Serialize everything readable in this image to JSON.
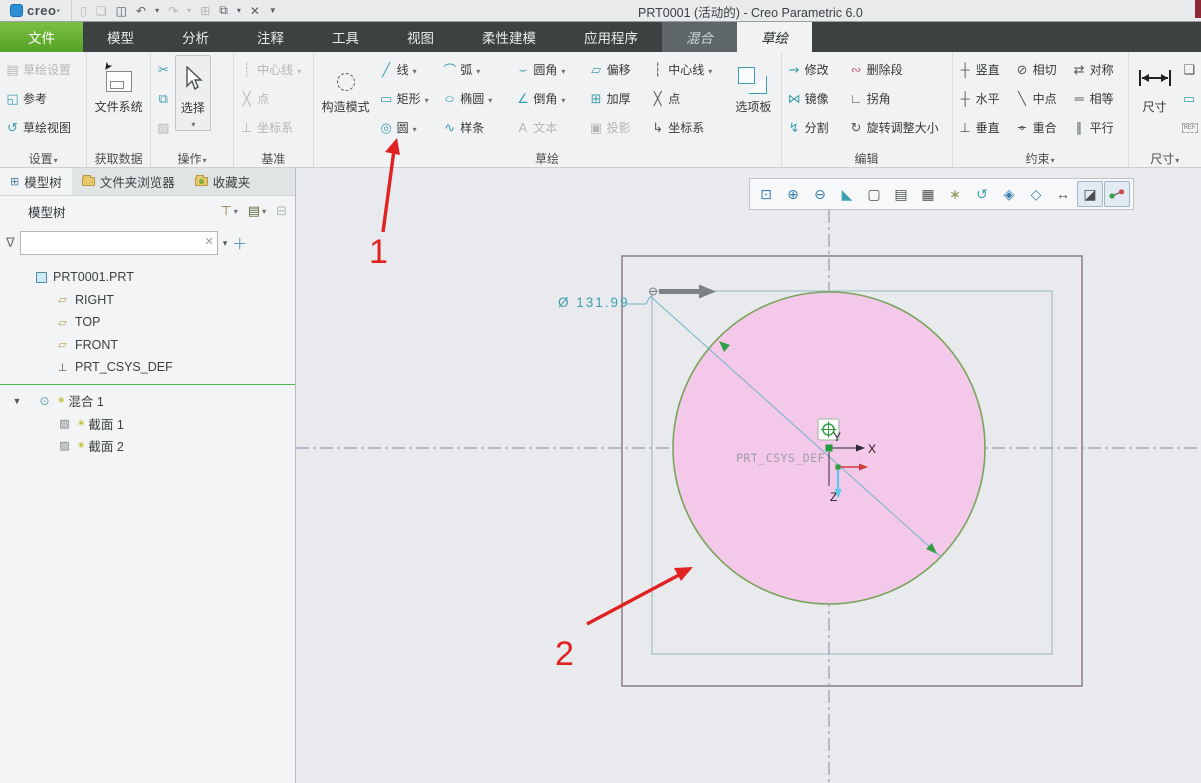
{
  "titlebar": {
    "logo": "creo·",
    "title": "PRT0001 (活动的) - Creo Parametric 6.0"
  },
  "tabs": {
    "file": "文件",
    "items": [
      "模型",
      "分析",
      "注释",
      "工具",
      "视图",
      "柔性建模",
      "应用程序"
    ],
    "highlight": "混合",
    "active": "草绘"
  },
  "ribbon": {
    "settings": {
      "label": "设置",
      "sketch_setup": "草绘设置",
      "reference": "参考",
      "sketch_view": "草绘视图"
    },
    "get_data": {
      "label": "获取数据",
      "file_system": "文件系统"
    },
    "operations": {
      "label": "操作",
      "select": "选择"
    },
    "datum": {
      "label": "基准",
      "centerline": "中心线",
      "point": "点",
      "csys": "坐标系"
    },
    "sketch": {
      "label": "草绘",
      "construction_mode": "构造模式",
      "palette": "选项板",
      "line": "线",
      "rect": "矩形",
      "circle": "圆",
      "arc": "弧",
      "ellipse": "椭圆",
      "spline": "样条",
      "fillet": "圆角",
      "chamfer": "倒角",
      "text": "文本",
      "offset": "偏移",
      "thicken": "加厚",
      "project": "投影",
      "centerline": "中心线",
      "point": "点",
      "csys": "坐标系"
    },
    "edit": {
      "label": "编辑",
      "modify": "修改",
      "mirror": "镜像",
      "divide": "分割",
      "delete_segment": "删除段",
      "corner": "拐角",
      "rotate_resize": "旋转调整大小"
    },
    "constraints": {
      "label": "约束",
      "vertical": "竖直",
      "horizontal": "水平",
      "perpendicular": "垂直",
      "tangent": "相切",
      "midpoint": "中点",
      "coincident": "重合",
      "symmetric": "对称",
      "equal": "相等",
      "parallel": "平行"
    },
    "dimension": {
      "label": "尺寸",
      "button": "尺寸",
      "ref": "REF"
    }
  },
  "navigator": {
    "tab_model_tree": "模型树",
    "tab_folder_browser": "文件夹浏览器",
    "tab_favorites": "收藏夹",
    "header": "模型树",
    "tree": {
      "root": "PRT0001.PRT",
      "right": "RIGHT",
      "top": "TOP",
      "front": "FRONT",
      "csys": "PRT_CSYS_DEF",
      "blend": "混合 1",
      "section1": "截面 1",
      "section2": "截面 2"
    }
  },
  "canvas": {
    "dimension": "Ø 131.99",
    "csys_label": "PRT_CSYS_DEF",
    "axis_x": "X",
    "axis_y": "Y",
    "axis_z": "Z",
    "note1": "1",
    "note2": "2",
    "colors": {
      "circle_fill": "#f3c8e8",
      "circle_stroke": "#7aa45c",
      "dim_color": "#3f9db0",
      "annotation": "#e02222",
      "outer_rect": "#8b7d84",
      "inner_rect": "#8fb8c0",
      "centerline": "#8a84ad"
    }
  }
}
